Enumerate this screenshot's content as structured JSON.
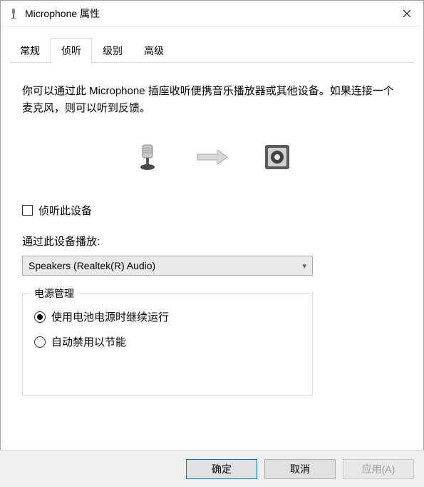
{
  "window": {
    "title": "Microphone 属性"
  },
  "tabs": [
    "常规",
    "侦听",
    "级别",
    "高级"
  ],
  "active_tab": 1,
  "description": "你可以通过此 Microphone 插座收听便携音乐播放器或其他设备。如果连接一个麦克风，则可以听到反馈。",
  "checkbox": {
    "label": "侦听此设备",
    "checked": false
  },
  "playback": {
    "label": "通过此设备播放:",
    "selected": "Speakers (Realtek(R) Audio)"
  },
  "power": {
    "legend": "电源管理",
    "options": [
      "使用电池电源时继续运行",
      "自动禁用以节能"
    ],
    "selected": 0
  },
  "buttons": {
    "ok": "确定",
    "cancel": "取消",
    "apply": "应用(A)"
  }
}
